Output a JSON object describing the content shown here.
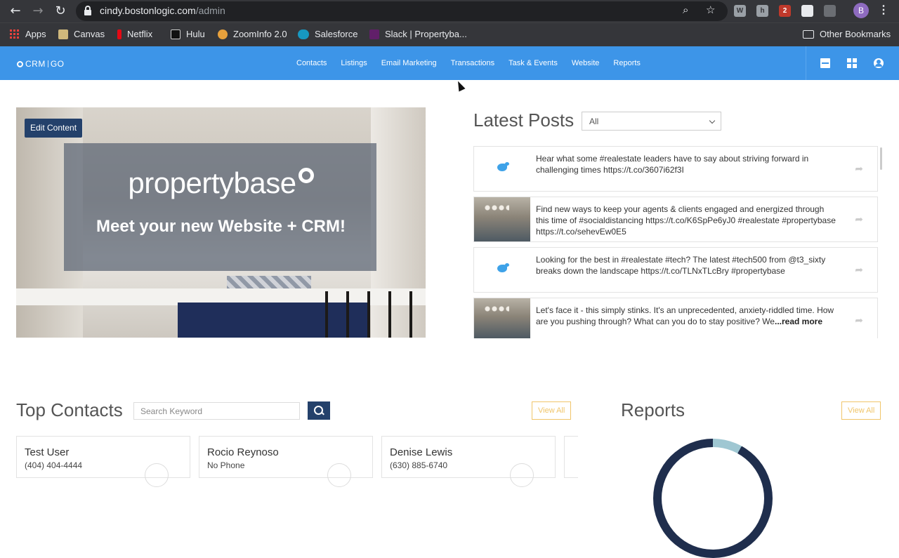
{
  "browser": {
    "url_host": "cindy.bostonlogic.com",
    "url_path": "/admin",
    "profile_initial": "B",
    "extension_badge": "2",
    "bookmarks": [
      {
        "label": "Apps",
        "icon": "apps-icon",
        "color": "#e8413c"
      },
      {
        "label": "Canvas",
        "icon": "canvas-icon",
        "color": "#cfb87c"
      },
      {
        "label": "Netflix",
        "icon": "netflix-icon",
        "color": "#e50914"
      },
      {
        "label": "Hulu",
        "icon": "hulu-icon",
        "color": "#111111"
      },
      {
        "label": "ZoomInfo 2.0",
        "icon": "zoominfo-icon",
        "color": "#e8a13c"
      },
      {
        "label": "Salesforce",
        "icon": "salesforce-icon",
        "color": "#1798c1"
      },
      {
        "label": "Slack | Propertyba...",
        "icon": "slack-icon",
        "color": "#611f69"
      }
    ],
    "other_bookmarks": "Other Bookmarks"
  },
  "header": {
    "logo_left": "CRM",
    "logo_right": "GO",
    "nav": [
      "Contacts",
      "Listings",
      "Email Marketing",
      "Transactions",
      "Task & Events",
      "Website",
      "Reports"
    ],
    "icons": [
      "mail-icon",
      "dashboard-grid-icon",
      "user-account-icon"
    ],
    "accent": "#3d95e8"
  },
  "hero": {
    "edit_label": "Edit Content",
    "brand": "propertybase",
    "tagline": "Meet your new Website + CRM!"
  },
  "posts": {
    "title": "Latest Posts",
    "filter_value": "All",
    "items": [
      {
        "thumb": "twitter-icon",
        "text": "Hear what some #realestate leaders have to say about striving forward in challenging times https://t.co/3607i62f3I",
        "more": ""
      },
      {
        "thumb": "photo",
        "text": "Find new ways to keep your agents & clients engaged and energized through this time of #socialdistancing https://t.co/K6SpPe6yJ0 #realestate #propertybase https://t.co/sehevEw0E5",
        "more": ""
      },
      {
        "thumb": "twitter-icon",
        "text": "Looking for the best in #realestate #tech? The latest #tech500 from @t3_sixty breaks down the landscape https://t.co/TLNxTLcBry #propertybase",
        "more": ""
      },
      {
        "thumb": "photo",
        "text": "Let's face it - this simply stinks. It's an unprecedented, anxiety-riddled time. How are you pushing through? What can you do to stay positive? We",
        "more": "...read more"
      }
    ]
  },
  "contacts": {
    "title": "Top Contacts",
    "search_placeholder": "Search Keyword",
    "view_all": "View All",
    "cards": [
      {
        "name": "Test User",
        "phone": "(404) 404-4444"
      },
      {
        "name": "Rocio Reynoso",
        "phone": "No Phone"
      },
      {
        "name": "Denise Lewis",
        "phone": "(630) 885-6740"
      }
    ]
  },
  "reports": {
    "title": "Reports",
    "view_all": "View All",
    "donut_colors": [
      "#9fc7d2",
      "#1f2e4d"
    ],
    "donut_share": 0.08
  }
}
